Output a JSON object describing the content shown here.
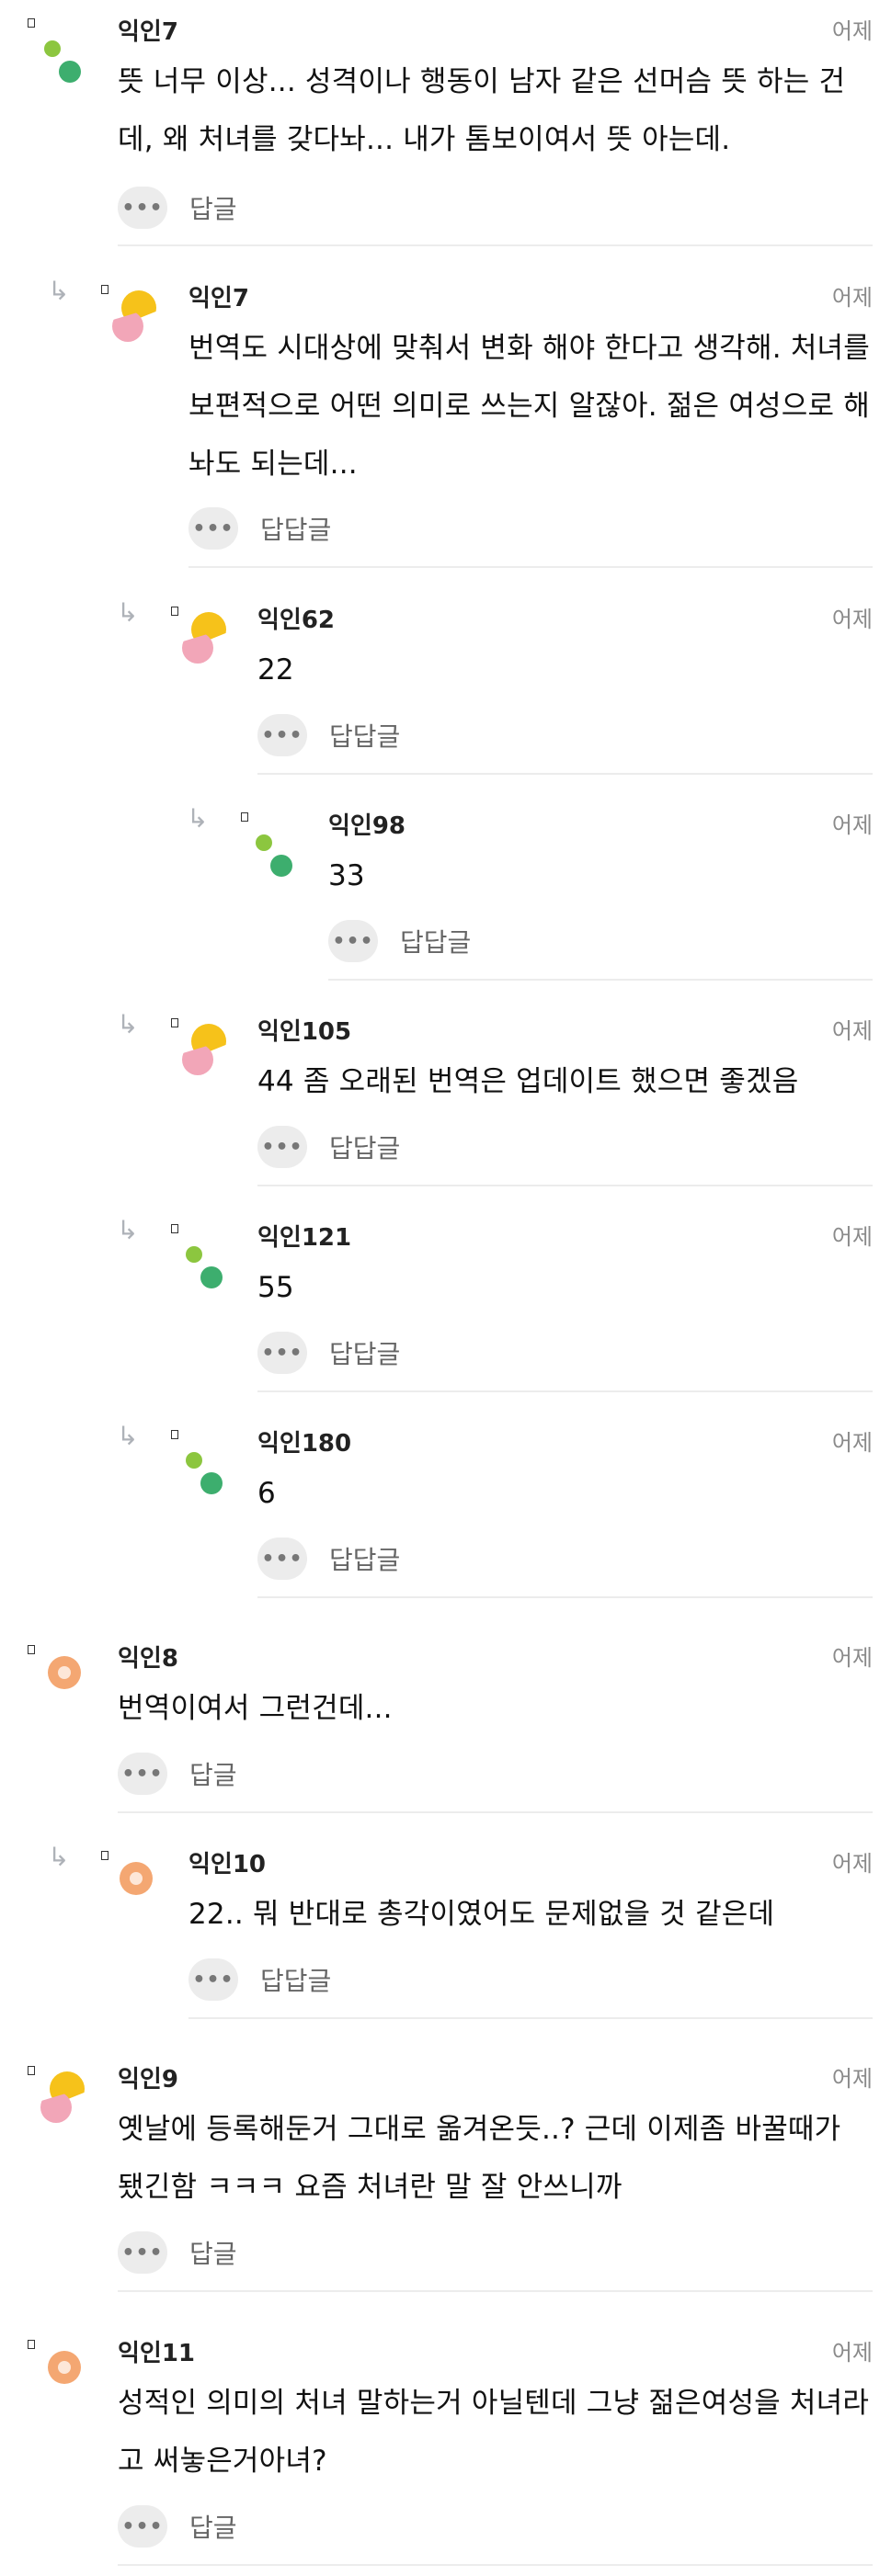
{
  "comments": [
    {
      "nick": "익인7",
      "time": "어제",
      "text": "뜻 너무 이상... 성격이나 행동이 남자 같은 선머슴 뜻 하는 건데, 왜 처녀를 갖다놔... 내가 톰보이여서 뜻 아는데.",
      "reply": "답글",
      "avatar": "dots-icon"
    },
    {
      "nick": "익인7",
      "time": "어제",
      "text": "번역도 시대상에 맞춰서 변화 해야 한다고 생각해. 처녀를 보편적으로 어떤 의미로 쓰는지 알잖아. 젊은 여성으로 해놔도 되는데...",
      "reply": "답답글",
      "avatar": "sun-icon"
    },
    {
      "nick": "익인62",
      "time": "어제",
      "text": "22",
      "reply": "답답글",
      "avatar": "sun-icon"
    },
    {
      "nick": "익인98",
      "time": "어제",
      "text": "33",
      "reply": "답답글",
      "avatar": "dots-icon"
    },
    {
      "nick": "익인105",
      "time": "어제",
      "text": "44 좀 오래된 번역은 업데이트 했으면 좋겠음",
      "reply": "답답글",
      "avatar": "sun-icon"
    },
    {
      "nick": "익인121",
      "time": "어제",
      "text": "55",
      "reply": "답답글",
      "avatar": "dots-icon"
    },
    {
      "nick": "익인180",
      "time": "어제",
      "text": "6",
      "reply": "답답글",
      "avatar": "dots-icon"
    },
    {
      "nick": "익인8",
      "time": "어제",
      "text": "번역이여서 그런건데...",
      "reply": "답글",
      "avatar": "circle-icon"
    },
    {
      "nick": "익인10",
      "time": "어제",
      "text": "22.. 뭐 반대로 총각이였어도 문제없을 것 같은데",
      "reply": "답답글",
      "avatar": "circle-icon"
    },
    {
      "nick": "익인9",
      "time": "어제",
      "text": "옛날에 등록해둔거 그대로 옮겨온듯..? 근데 이제좀 바꿀때가 됐긴함 ㅋㅋㅋ 요즘 처녀란 말 잘 안쓰니까",
      "reply": "답글",
      "avatar": "sun-icon"
    },
    {
      "nick": "익인11",
      "time": "어제",
      "text": "성적인 의미의 처녀 말하는거 아닐텐데 그냥 젊은여성을 처녀라고 써놓은거아녀?",
      "reply": "답글",
      "avatar": "circle-icon"
    }
  ],
  "ui": {
    "more_glyph": "•••",
    "reply_arrow": "↳"
  }
}
